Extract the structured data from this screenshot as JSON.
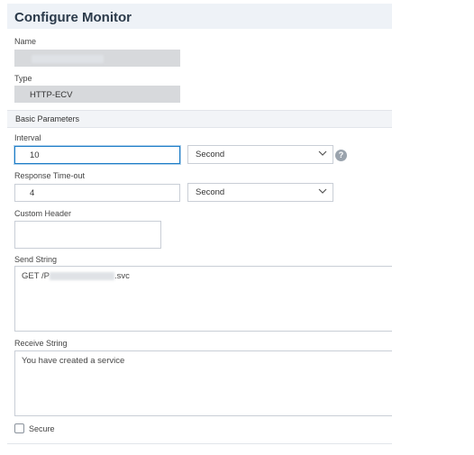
{
  "title": "Configure Monitor",
  "name": {
    "label": "Name",
    "value": ""
  },
  "type": {
    "label": "Type",
    "value": "HTTP-ECV"
  },
  "basic_parameters": {
    "label": "Basic Parameters"
  },
  "interval": {
    "label": "Interval",
    "value": "10",
    "unit": "Second"
  },
  "response_timeout": {
    "label": "Response Time-out",
    "value": "4",
    "unit": "Second"
  },
  "custom_header": {
    "label": "Custom Header",
    "value": ""
  },
  "send_string": {
    "label": "Send String",
    "prefix": "GET /P",
    "suffix": ".svc"
  },
  "receive_string": {
    "label": "Receive String",
    "value": "You have created a service"
  },
  "secure": {
    "label": "Secure",
    "checked": false
  },
  "help_icon": {
    "glyph": "?"
  },
  "colors": {
    "focus": "#1c7cc7",
    "header_bg": "#eef2f7",
    "disabled_bg": "#d7d9dc"
  }
}
